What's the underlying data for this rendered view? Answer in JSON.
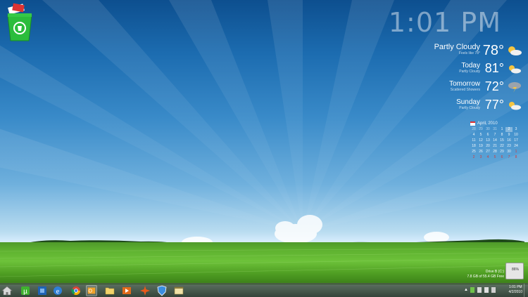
{
  "clock": {
    "time": "1:01 PM"
  },
  "weather": [
    {
      "title": "Partly Cloudy",
      "sub": "Feels like 78°",
      "temp": "78°",
      "icon": "partly-cloudy-icon"
    },
    {
      "title": "Today",
      "sub": "Partly Cloudy",
      "temp": "81°",
      "icon": "partly-cloudy-icon"
    },
    {
      "title": "Tomorrow",
      "sub": "Scattered Showers",
      "temp": "72°",
      "icon": "storm-icon"
    },
    {
      "title": "Sunday",
      "sub": "Partly Cloudy",
      "temp": "77°",
      "icon": "partly-cloudy-icon"
    }
  ],
  "calendar": {
    "month": "April, 2010",
    "rows": [
      [
        "28",
        "29",
        "30",
        "31",
        "1",
        "2",
        "3"
      ],
      [
        "4",
        "5",
        "6",
        "7",
        "8",
        "9",
        "10"
      ],
      [
        "11",
        "12",
        "13",
        "14",
        "15",
        "16",
        "17"
      ],
      [
        "18",
        "19",
        "20",
        "21",
        "22",
        "23",
        "24"
      ],
      [
        "25",
        "26",
        "27",
        "28",
        "29",
        "30",
        "1"
      ],
      [
        "2",
        "3",
        "4",
        "5",
        "6",
        "7",
        "8"
      ]
    ],
    "today": "2"
  },
  "drive": {
    "name": "Drive B (C:)",
    "free": "7.8 GB of 55.4 GB Free",
    "percent": "86%"
  },
  "taskbar": {
    "apps": [
      "home-icon",
      "utorrent-icon",
      "cpu-icon",
      "internet-explorer-icon",
      "chrome-icon",
      "outlook-icon",
      "folder-icon",
      "media-player-icon",
      "app-star-icon",
      "shield-icon",
      "window-icon"
    ]
  },
  "tray": {
    "time": "1:01 PM",
    "date": "4/2/2010"
  }
}
